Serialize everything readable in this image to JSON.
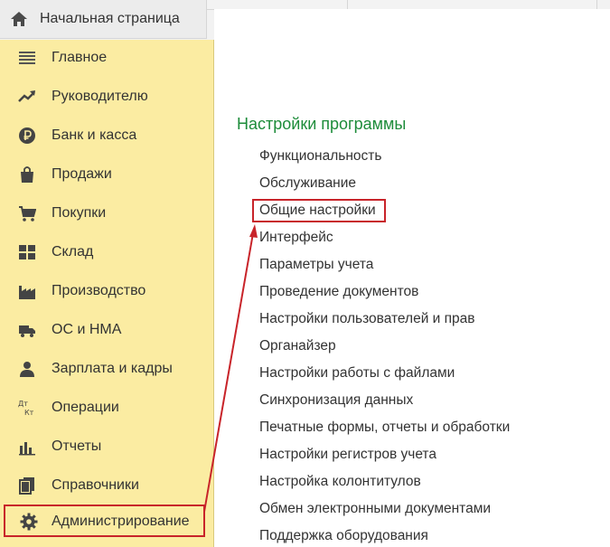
{
  "home_tab": {
    "label": "Начальная страница",
    "icon": "home-icon"
  },
  "sidebar": {
    "items": [
      {
        "label": "Главное",
        "icon": "menu-lines-icon"
      },
      {
        "label": "Руководителю",
        "icon": "trend-up-icon"
      },
      {
        "label": "Банк и касса",
        "icon": "ruble-coin-icon"
      },
      {
        "label": "Продажи",
        "icon": "shopping-bag-icon"
      },
      {
        "label": "Покупки",
        "icon": "cart-icon"
      },
      {
        "label": "Склад",
        "icon": "warehouse-grid-icon"
      },
      {
        "label": "Производство",
        "icon": "factory-icon"
      },
      {
        "label": "ОС и НМА",
        "icon": "truck-icon"
      },
      {
        "label": "Зарплата и кадры",
        "icon": "person-icon"
      },
      {
        "label": "Операции",
        "icon": "dt-kt-icon",
        "icon_text": [
          "Дт",
          "Кт"
        ]
      },
      {
        "label": "Отчеты",
        "icon": "bar-chart-icon"
      },
      {
        "label": "Справочники",
        "icon": "books-icon"
      },
      {
        "label": "Администрирование",
        "icon": "gear-icon",
        "highlighted": true
      }
    ]
  },
  "main": {
    "section_title": "Настройки программы",
    "links": [
      "Функциональность",
      "Обслуживание",
      "Общие настройки",
      "Интерфейс",
      "Параметры учета",
      "Проведение документов",
      "Настройки пользователей и прав",
      "Органайзер",
      "Настройки работы с файлами",
      "Синхронизация данных",
      "Печатные формы, отчеты и обработки",
      "Настройки регистров учета",
      "Настройка колонтитулов",
      "Обмен электронными документами",
      "Поддержка оборудования"
    ],
    "highlighted_link": "Общие настройки"
  },
  "colors": {
    "sidebar_bg": "#fbeca2",
    "section_title": "#1d8c3a",
    "highlight": "#c8242a",
    "text": "#333333"
  }
}
